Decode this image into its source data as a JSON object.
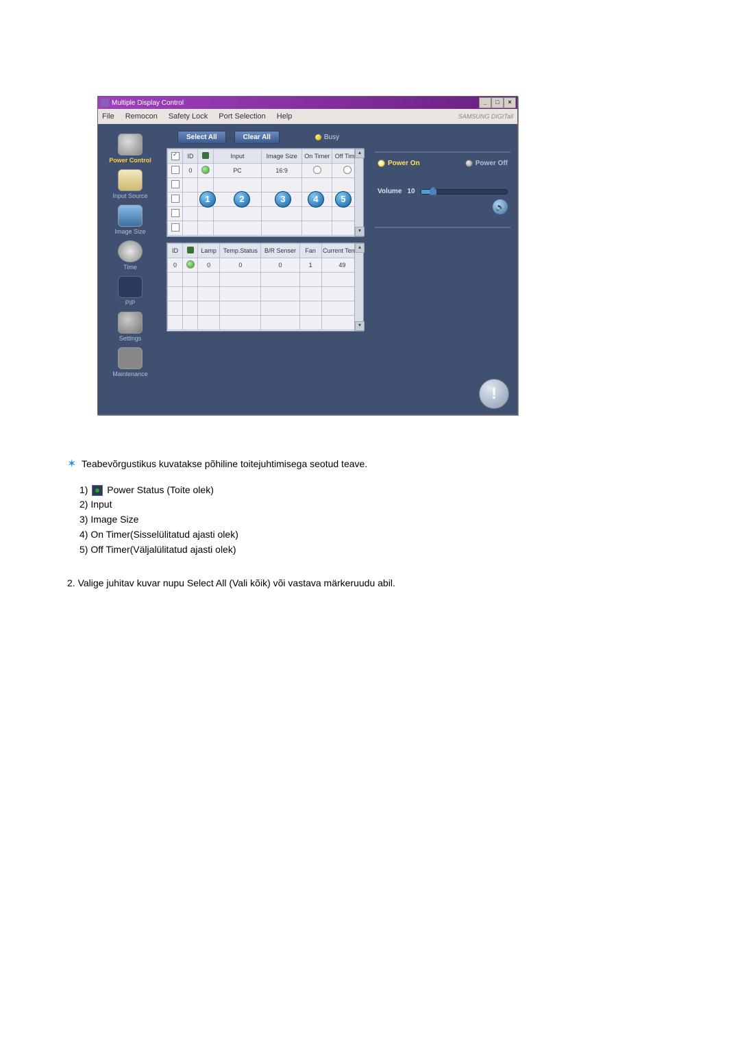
{
  "window": {
    "title": "Multiple Display Control",
    "brand": "SAMSUNG DIGITall"
  },
  "menu": [
    "File",
    "Remocon",
    "Safety Lock",
    "Port Selection",
    "Help"
  ],
  "sidebar": [
    {
      "label": "Power Control",
      "active": true
    },
    {
      "label": "Input Source"
    },
    {
      "label": "Image Size"
    },
    {
      "label": "Time"
    },
    {
      "label": "PIP"
    },
    {
      "label": "Settings"
    },
    {
      "label": "Maintenance"
    }
  ],
  "buttons": {
    "select_all": "Select All",
    "clear_all": "Clear All",
    "busy": "Busy",
    "power_on": "Power On",
    "power_off": "Power Off"
  },
  "volume": {
    "label": "Volume",
    "value": "10"
  },
  "grid1": {
    "headers": [
      "",
      "ID",
      "",
      "Input",
      "Image Size",
      "On Timer",
      "Off Timer"
    ],
    "rows": [
      {
        "checked": true,
        "id": "0",
        "status": "on",
        "input": "PC",
        "imagesize": "16:9",
        "ontimer": "○",
        "offtimer": "○"
      },
      {
        "checked": false
      },
      {
        "checked": false
      },
      {
        "checked": false
      },
      {
        "checked": false
      }
    ]
  },
  "grid2": {
    "headers": [
      "ID",
      "",
      "Lamp",
      "Temp.Status",
      "B/R Senser",
      "Fan",
      "Current Temp."
    ],
    "rows": [
      {
        "id": "0",
        "status": "on",
        "lamp": "0",
        "tempstatus": "0",
        "brsenser": "0",
        "fan": "1",
        "curtemp": "49"
      },
      {},
      {},
      {},
      {}
    ]
  },
  "callouts": [
    "1",
    "2",
    "3",
    "4",
    "5"
  ],
  "doc": {
    "intro": "Teabevõrgustikus kuvatakse põhiline toitejuhtimisega seotud teave.",
    "items": [
      "Power Status (Toite olek)",
      "Input",
      "Image Size",
      "On Timer(Sisselülitatud ajasti olek)",
      "Off Timer(Väljalülitatud ajasti olek)"
    ],
    "second": "2.  Valige juhitav kuvar nupu Select All (Vali kõik) või vastava märkeruudu abil."
  }
}
